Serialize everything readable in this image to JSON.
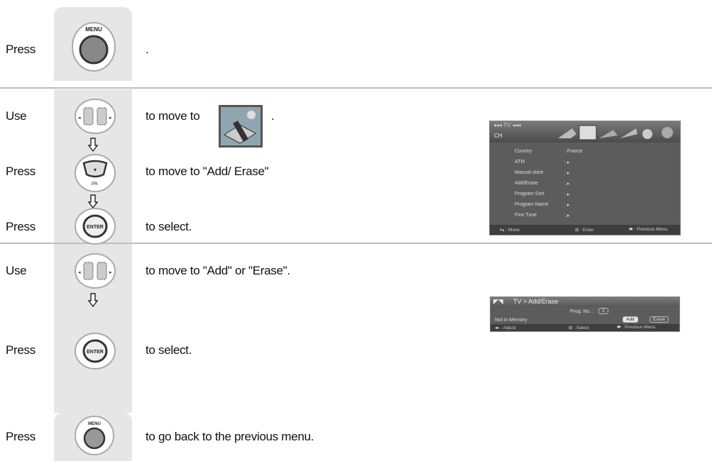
{
  "steps": [
    {
      "word": "Press",
      "button_icon": "menu-button",
      "button_text": "MENU",
      "desc": "."
    },
    {
      "word": "Use",
      "button_icon": "left-right-button",
      "desc": "to move to",
      "trail": "."
    },
    {
      "word": "Press",
      "button_icon": "down-button",
      "button_text": "PR-",
      "desc": "to move to \"Add/ Erase\""
    },
    {
      "word": "Press",
      "button_icon": "enter-button",
      "button_text": "ENTER",
      "desc": "to select."
    },
    {
      "word": "Use",
      "button_icon": "left-right-button",
      "desc": "to move to  \"Add\" or \"Erase\"."
    },
    {
      "word": "Press",
      "button_icon": "enter-button",
      "button_text": "ENTER",
      "desc": "to select."
    },
    {
      "word": "Press",
      "button_icon": "menu-button",
      "button_text": "MENU",
      "desc": "to go back to the previous menu."
    }
  ],
  "menu_panel": {
    "tv_label": "◂◂◂ TV ◂◂◂",
    "section": "CH",
    "rows": [
      {
        "label": "Country",
        "value": ": France"
      },
      {
        "label": "ATM",
        "value": ": ▸"
      },
      {
        "label": "Manual store",
        "value": ": ▸"
      },
      {
        "label": "Add/Erase",
        "value": ": ▸"
      },
      {
        "label": "Program Sort",
        "value": ": ▸"
      },
      {
        "label": "Program Name",
        "value": ": ▸"
      },
      {
        "label": "Fine Tune",
        "value": ": ▸"
      }
    ],
    "footer": {
      "move": "▾▴ : Move",
      "enter": "⊞ : Enter",
      "prev": "⬬ : Previous Menu"
    }
  },
  "add_erase_panel": {
    "title": "TV > Add/Erase",
    "prog_label": "Prog. No.  :",
    "prog_value": "3",
    "status": "Not in Memory",
    "add_label": "Add",
    "erase_label": "Erase",
    "footer": {
      "adjust": "◂▸ : Adjust",
      "select": "⊞ : Select",
      "prev": "⬬ : Previous Menu"
    }
  }
}
